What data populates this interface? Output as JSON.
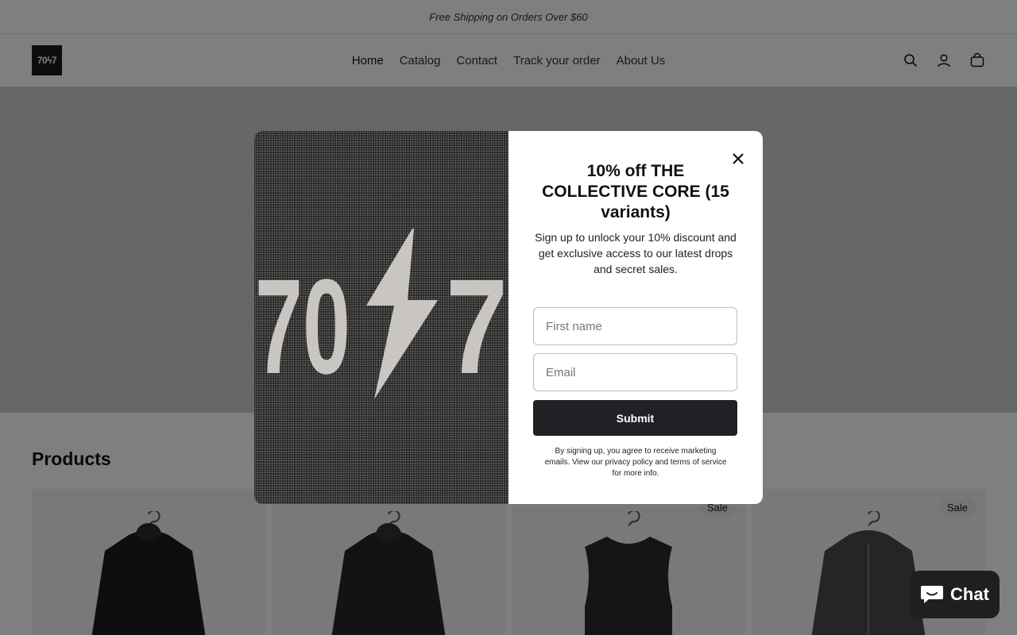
{
  "announcement": {
    "text": "Free Shipping on Orders Over $60"
  },
  "header": {
    "logo_text": "70ϟ7",
    "nav": [
      "Home",
      "Catalog",
      "Contact",
      "Track your order",
      "About Us"
    ],
    "icons": [
      "search-icon",
      "account-icon",
      "cart-icon"
    ]
  },
  "products": {
    "title": "Products",
    "cards": [
      {
        "sale_label": "",
        "garment": "hoodie",
        "color": "#1c1c1c"
      },
      {
        "sale_label": "",
        "garment": "hoodie",
        "color": "#262626"
      },
      {
        "sale_label": "Sale",
        "garment": "tank",
        "color": "#2a2a2a"
      },
      {
        "sale_label": "Sale",
        "garment": "zip-hoodie",
        "color": "#4a4a4a"
      }
    ]
  },
  "modal": {
    "brand_mark": "70ϟ7",
    "title": "10% off THE COLLECTIVE CORE (15 variants)",
    "subtitle": "Sign up to unlock your 10% discount and get exclusive access to our latest drops and secret sales.",
    "first_name_placeholder": "First name",
    "email_placeholder": "Email",
    "submit_label": "Submit",
    "legal": "By signing up, you agree to receive marketing emails. View our privacy policy and terms of service for more info."
  },
  "chat": {
    "label": "Chat"
  },
  "colors": {
    "overlay": "rgba(0,0,0,0.5)",
    "button": "#202124",
    "chat_bg": "#1f1f1f"
  }
}
